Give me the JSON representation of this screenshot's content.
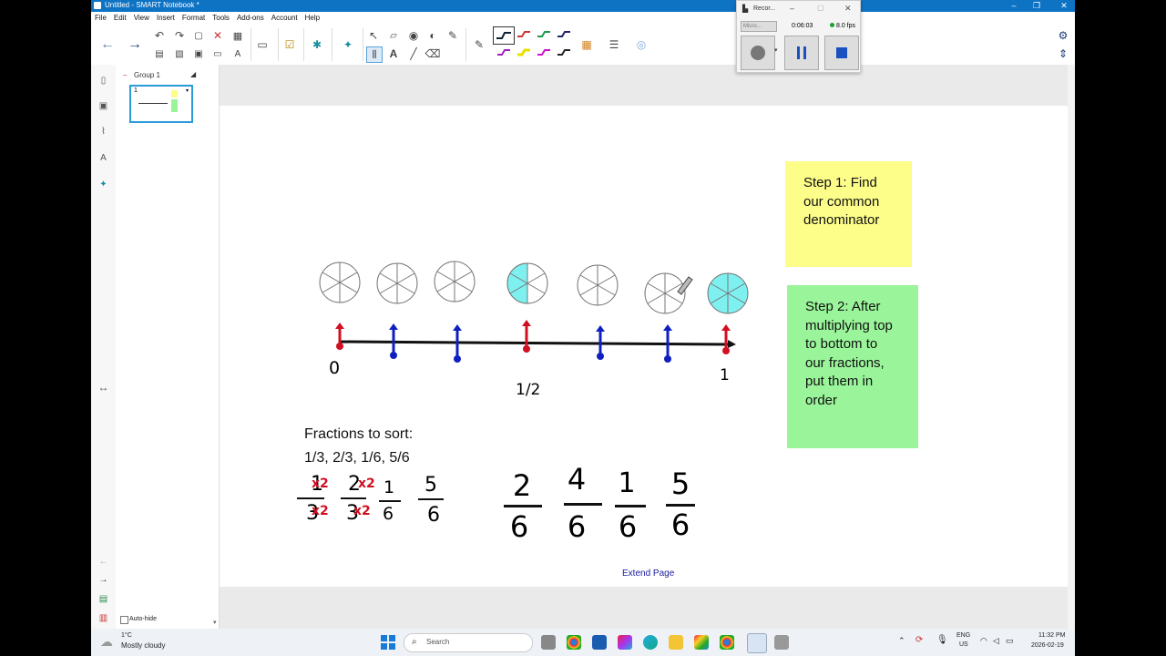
{
  "window": {
    "title": "Untitled - SMART Notebook *"
  },
  "menu": [
    "File",
    "Edit",
    "View",
    "Insert",
    "Format",
    "Tools",
    "Add-ons",
    "Account",
    "Help"
  ],
  "sorter": {
    "group_label": "Group 1",
    "page_number": "1",
    "autohide_label": "Auto-hide"
  },
  "recorder": {
    "title": "Recor...",
    "mode": "Micro...",
    "time": "0:06:03",
    "fps": "8.0 fps"
  },
  "notes": {
    "step1": "Step 1: Find our common denominator",
    "step2": "Step 2: After multiplying top to bottom to our fractions, put them in order"
  },
  "number_line": {
    "label_zero": "0",
    "label_half": "1/2",
    "label_one": "1"
  },
  "sort": {
    "heading": "Fractions to sort:",
    "list": "1/3, 2/3, 1/6, 5/6"
  },
  "fractions_left": [
    {
      "num": "1",
      "den": "3",
      "mult": "x2"
    },
    {
      "num": "2",
      "den": "3",
      "mult": "x2"
    },
    {
      "num": "1",
      "den": "6",
      "mult": ""
    },
    {
      "num": "5",
      "den": "6",
      "mult": ""
    }
  ],
  "fractions_right": [
    {
      "num": "2",
      "den": "6"
    },
    {
      "num": "4",
      "den": "6"
    },
    {
      "num": "1",
      "den": "6"
    },
    {
      "num": "5",
      "den": "6"
    }
  ],
  "extend_page": "Extend Page",
  "taskbar": {
    "weather_temp": "1°C",
    "weather_desc": "Mostly cloudy",
    "search_placeholder": "Search",
    "lang": "ENG",
    "region": "US",
    "time": "11:32 PM",
    "date": "2026-02-19"
  },
  "colors": {
    "accent": "#0f73c4",
    "sticky_yellow": "#fdfd8a",
    "sticky_green": "#9af59a",
    "shaded": "#7ff0f0",
    "red_mark": "#d01020",
    "blue_mark": "#1020c0"
  }
}
